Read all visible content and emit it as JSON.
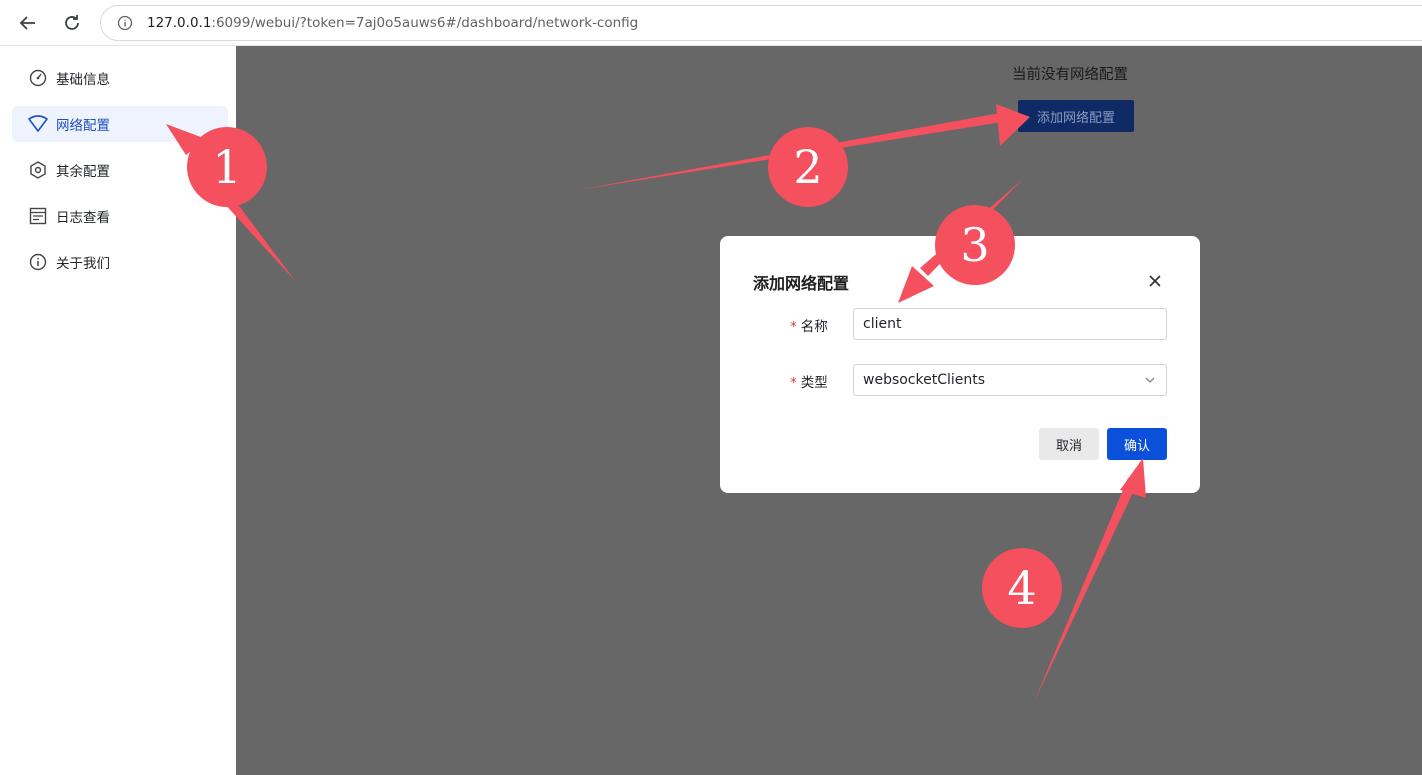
{
  "browser": {
    "url_host": "127.0.0.1",
    "url_rest": ":6099/webui/?token=7aj0o5auws6#/dashboard/network-config"
  },
  "sidebar": {
    "items": [
      {
        "label": "基础信息",
        "icon": "dashboard-gauge-icon",
        "active": false
      },
      {
        "label": "网络配置",
        "icon": "wifi-icon",
        "active": true
      },
      {
        "label": "其余配置",
        "icon": "settings-hexagon-icon",
        "active": false
      },
      {
        "label": "日志查看",
        "icon": "log-list-icon",
        "active": false
      },
      {
        "label": "关于我们",
        "icon": "info-circle-icon",
        "active": false
      }
    ]
  },
  "main": {
    "empty_text": "当前没有网络配置",
    "add_button_label": "添加网络配置"
  },
  "dialog": {
    "title": "添加网络配置",
    "name_label": "名称",
    "name_value": "client",
    "type_label": "类型",
    "type_value": "websocketClients",
    "cancel_label": "取消",
    "confirm_label": "确认"
  },
  "annotations": {
    "steps": [
      "1",
      "2",
      "3",
      "4"
    ],
    "color": "#f4505e"
  }
}
